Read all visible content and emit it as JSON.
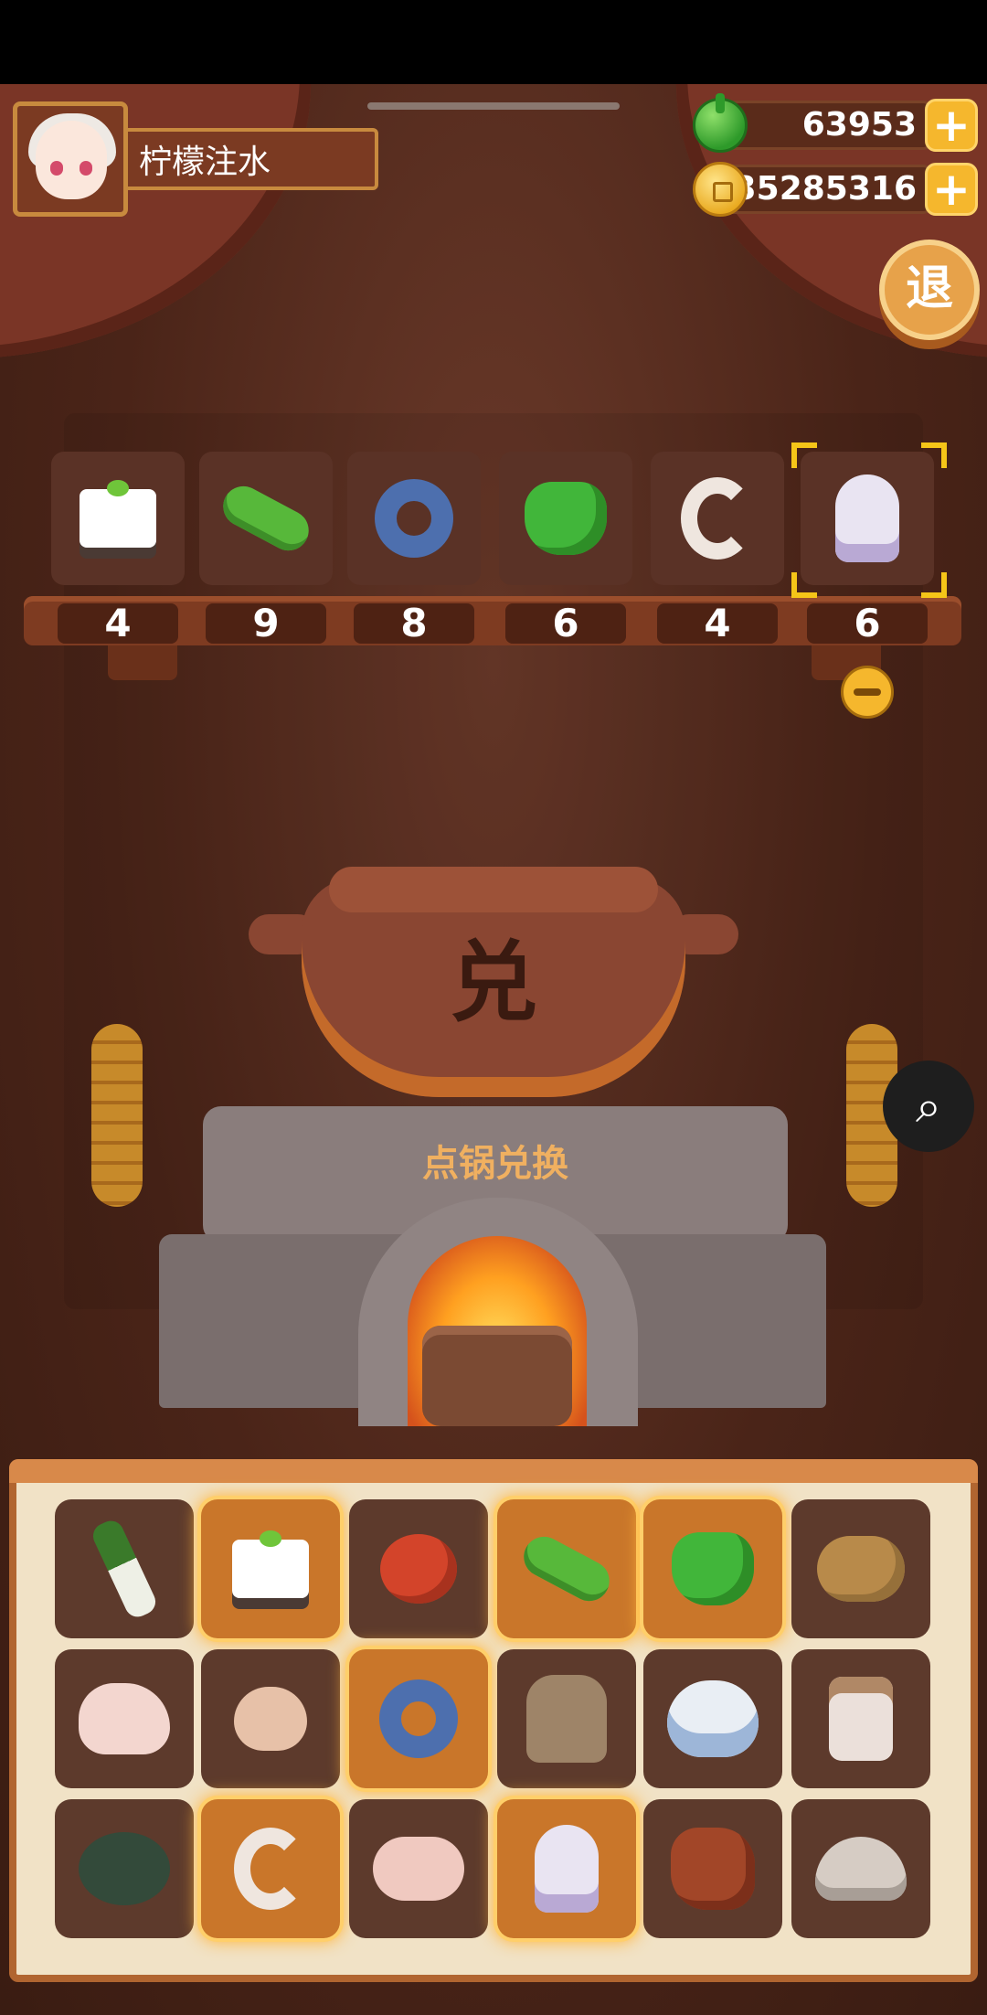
{
  "player": {
    "name": "柠檬注水"
  },
  "currencies": {
    "gems": "63953",
    "coins": "35285316"
  },
  "exit_button_label": "退",
  "pot": {
    "character": "兑",
    "action_label": "点锅兑换"
  },
  "selected_ingredients": [
    {
      "item": "tofu",
      "count": "4"
    },
    {
      "item": "cucumber",
      "count": "9"
    },
    {
      "item": "fish",
      "count": "8"
    },
    {
      "item": "green-pepper",
      "count": "6"
    },
    {
      "item": "shrimp",
      "count": "4"
    },
    {
      "item": "squid",
      "count": "6"
    }
  ],
  "inventory": [
    {
      "item": "leek",
      "active": false
    },
    {
      "item": "tofu",
      "active": true
    },
    {
      "item": "tomato",
      "active": false
    },
    {
      "item": "cucumber",
      "active": true
    },
    {
      "item": "green-pepper",
      "active": true
    },
    {
      "item": "potato",
      "active": false
    },
    {
      "item": "chicken",
      "active": false
    },
    {
      "item": "egg",
      "active": false
    },
    {
      "item": "fish",
      "active": true
    },
    {
      "item": "flour-sack",
      "active": false
    },
    {
      "item": "rice-bowl",
      "active": false
    },
    {
      "item": "jar",
      "active": false
    },
    {
      "item": "crab",
      "active": false
    },
    {
      "item": "shrimp",
      "active": true
    },
    {
      "item": "duck",
      "active": false
    },
    {
      "item": "squid",
      "active": true
    },
    {
      "item": "meat",
      "active": false
    },
    {
      "item": "clam",
      "active": false
    }
  ]
}
